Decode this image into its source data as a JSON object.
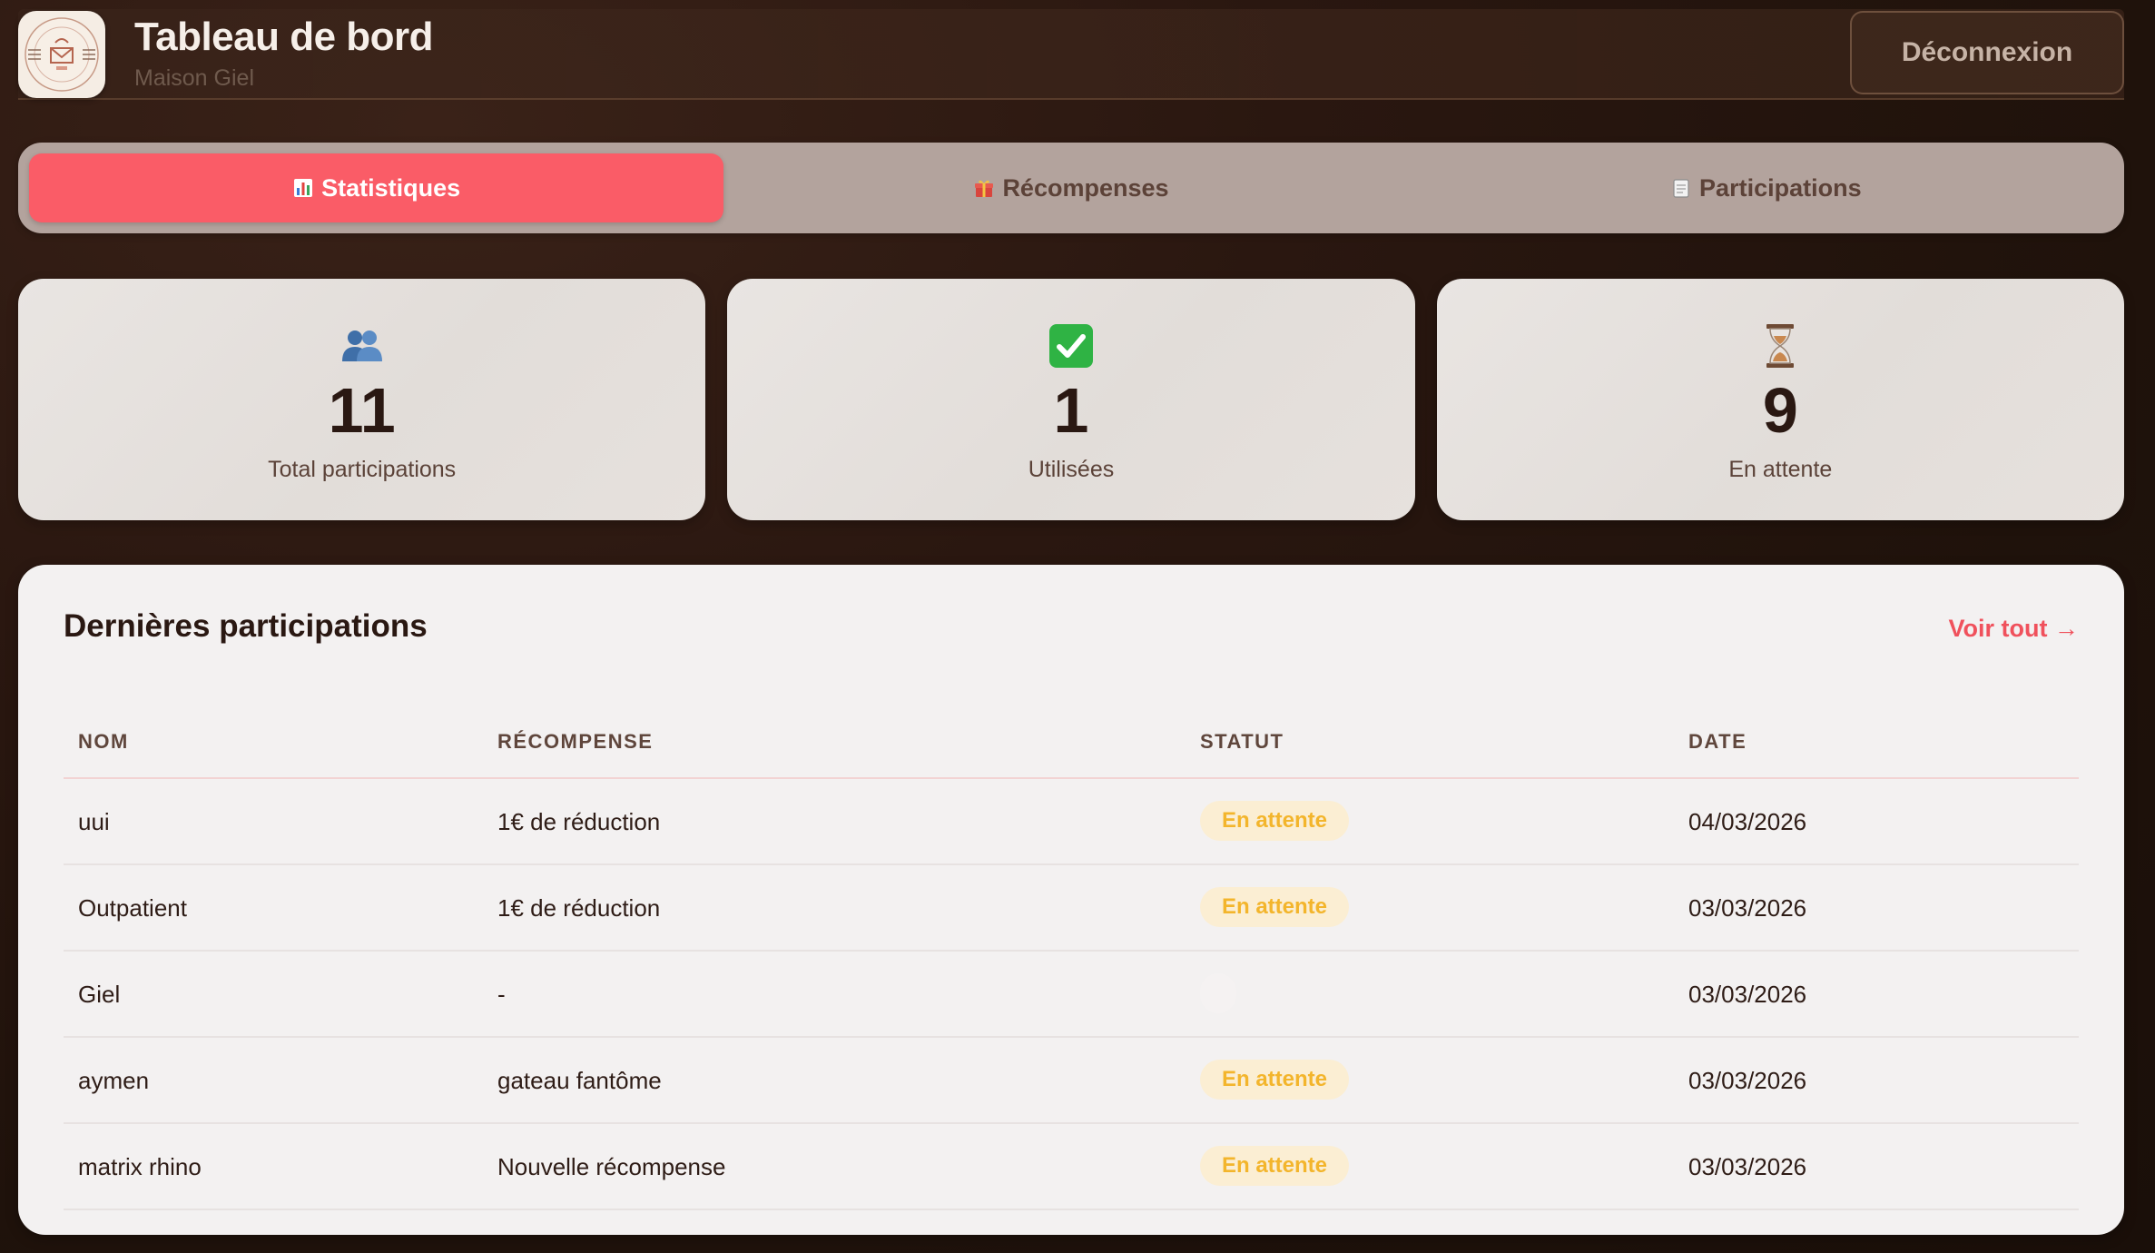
{
  "header": {
    "title": "Tableau de bord",
    "subtitle": "Maison Giel",
    "logout_label": "Déconnexion",
    "logo_icon": "maison-giel-logo"
  },
  "tabs": [
    {
      "label": "Statistiques",
      "icon": "bar-chart-icon",
      "active": true
    },
    {
      "label": "Récompenses",
      "icon": "gift-icon",
      "active": false
    },
    {
      "label": "Participations",
      "icon": "clipboard-icon",
      "active": false
    }
  ],
  "stats": [
    {
      "icon": "users-icon",
      "value": "11",
      "label": "Total participations"
    },
    {
      "icon": "check-icon",
      "value": "1",
      "label": "Utilisées"
    },
    {
      "icon": "hourglass-icon",
      "value": "9",
      "label": "En attente"
    }
  ],
  "recent": {
    "title": "Dernières participations",
    "see_all": "Voir tout →",
    "columns": [
      "NOM",
      "RÉCOMPENSE",
      "STATUT",
      "DATE"
    ],
    "rows": [
      {
        "name": "uui",
        "reward": "1€ de réduction",
        "status": "En attente",
        "date": "04/03/2026"
      },
      {
        "name": "Outpatient",
        "reward": "1€ de réduction",
        "status": "En attente",
        "date": "03/03/2026"
      },
      {
        "name": "Giel",
        "reward": "-",
        "status": "",
        "date": "03/03/2026"
      },
      {
        "name": "aymen",
        "reward": "gateau fantôme",
        "status": "En attente",
        "date": "03/03/2026"
      },
      {
        "name": "matrix rhino",
        "reward": "Nouvelle récompense",
        "status": "En attente",
        "date": "03/03/2026"
      }
    ]
  },
  "colors": {
    "accent": "#fa5c67",
    "pending_text": "#f3b52c",
    "pending_bg": "#fbeed3",
    "background": "#2a1710"
  }
}
